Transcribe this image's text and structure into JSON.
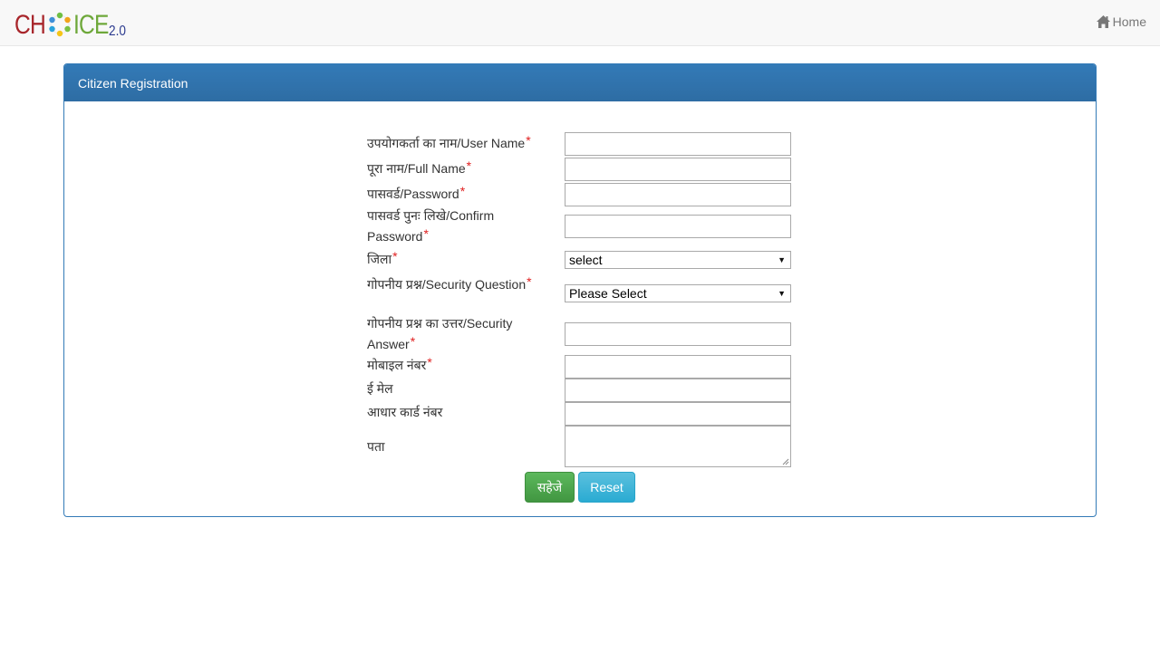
{
  "navbar": {
    "logo": {
      "part1": "CH",
      "part2": "ICE",
      "version": "2.0",
      "colors": {
        "ch": "#a8262b",
        "ice": "#6ea83a",
        "version": "#2b3a8f"
      }
    },
    "home_link": {
      "icon": "home-icon",
      "label": "Home"
    }
  },
  "panel": {
    "title": "Citizen Registration",
    "accent": "#337ab7"
  },
  "form": {
    "required_marker": "*",
    "fields": {
      "username": {
        "label": "उपयोगकर्ता का नाम/User Name",
        "required": true,
        "value": ""
      },
      "fullname": {
        "label": "पूरा नाम/Full Name",
        "required": true,
        "value": ""
      },
      "password": {
        "label": "पासवर्ड/Password",
        "required": true,
        "value": ""
      },
      "confirm_password": {
        "label_line1": "पासवर्ड पुनः लिखे/Confirm",
        "label_line2": "Password",
        "required": true,
        "value": ""
      },
      "district": {
        "label": "जिला",
        "required": true,
        "selected": "select"
      },
      "security_question": {
        "label": "गोपनीय प्रश्न/Security Question",
        "required": true,
        "selected": "Please Select"
      },
      "security_answer": {
        "label_line1": "गोपनीय प्रश्न का उत्तर/Security",
        "label_line2": "Answer",
        "required": true,
        "value": ""
      },
      "mobile": {
        "label": "मोबाइल नंबर",
        "required": true,
        "value": ""
      },
      "email": {
        "label": "ई मेल",
        "required": false,
        "value": ""
      },
      "aadhaar": {
        "label": "आधार कार्ड नंबर",
        "required": false,
        "value": ""
      },
      "address": {
        "label": "पता",
        "required": false,
        "value": ""
      }
    },
    "buttons": {
      "save": {
        "label": "सहेजे",
        "color": "#5cb85c"
      },
      "reset": {
        "label": "Reset",
        "color": "#5bc0de"
      }
    }
  }
}
